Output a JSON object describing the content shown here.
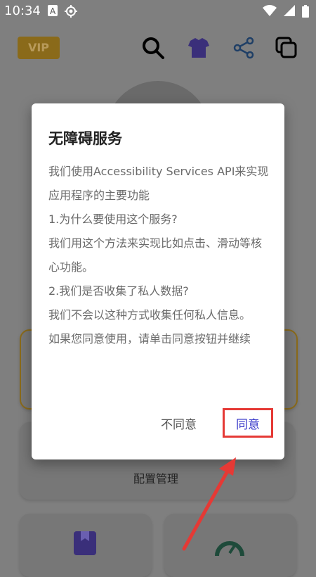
{
  "status_bar": {
    "time": "10:34",
    "icons": [
      "notification-a-icon",
      "target-icon",
      "wifi-icon",
      "signal-icon",
      "battery-icon"
    ]
  },
  "header": {
    "vip_label": "VIP"
  },
  "background": {
    "config_card_label": "配置管理"
  },
  "dialog": {
    "title": "无障碍服务",
    "paragraphs": [
      "我们使用Accessibility Services API来实现应用程序的主要功能",
      "1.为什么要使用这个服务?",
      "我们用这个方法来实现比如点击、滑动等核心功能。",
      "2.我们是否收集了私人数据?",
      "我们不会以这种方式收集任何私人信息。",
      "如果您同意使用，请单击同意按钮并继续"
    ],
    "disagree_label": "不同意",
    "agree_label": "同意"
  },
  "colors": {
    "agree_text": "#3535c8",
    "highlight_border": "#e53935",
    "arrow": "#e53935"
  }
}
